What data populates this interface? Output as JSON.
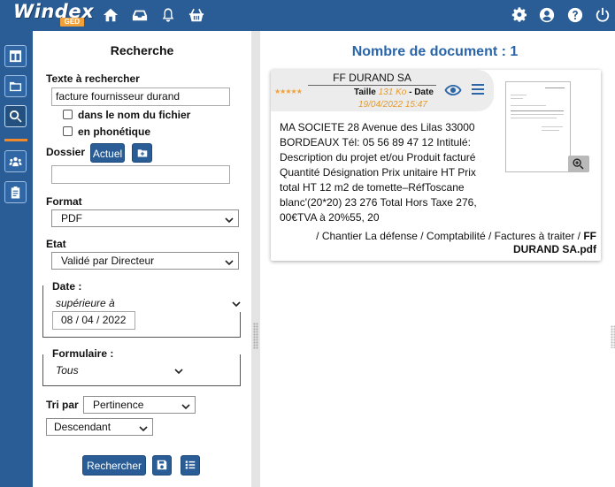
{
  "app": {
    "logo_text": "Windex",
    "logo_sub": "GED",
    "top_icons_left": [
      "home-icon",
      "inbox-icon",
      "bell-icon",
      "basket-icon"
    ],
    "top_icons_right": [
      "gear-icon",
      "user-icon",
      "help-icon",
      "power-icon"
    ],
    "accent": "#2a5d96",
    "highlight": "#f0a13a"
  },
  "rail": {
    "items": [
      "columns-icon",
      "folder-icon",
      "search-icon",
      "users-icon",
      "clipboard-icon"
    ]
  },
  "search": {
    "title": "Recherche",
    "text_label": "Texte à rechercher",
    "text_value": "facture fournisseur durand",
    "opt_filename": "dans le nom du fichier",
    "opt_phonetic": "en phonétique",
    "folder_label": "Dossier",
    "folder_button": "Actuel",
    "folder_value": "",
    "format_label": "Format",
    "format_value": "PDF",
    "state_label": "Etat",
    "state_value": "Validé par Directeur",
    "date_label": "Date :",
    "date_operator": "supérieure à",
    "date_value": "08 / 04 / 2022",
    "form_label": "Formulaire :",
    "form_value": "Tous",
    "sort_label": "Tri par",
    "sort_value": "Pertinence",
    "order_value": "Descendant",
    "search_button": "Rechercher"
  },
  "results": {
    "title": "Nombre de document : 1",
    "card": {
      "name": "FF DURAND SA",
      "stars": "★★★★★",
      "size_label": "Taille",
      "size_value": "131 Ko",
      "date_label": "- Date",
      "date_value": "19/04/2022 15:47",
      "summary": "MA SOCIETE 28 Avenue des Lilas 33000 BORDEAUX Tél: 05 56 89 47 12 Intitulé: Description du projet et/ou Produit facturé Quantité Désignation Prix unitaire HT Prix total HT 12 m2 de tomette–RéfToscane blanc'(20*20) 23 276 Total Hors Taxe 276, 00€TVA à 20%55, 20",
      "path": "/  Chantier La défense / Comptabilité / Factures à traiter /",
      "file": "FF DURAND SA.pdf"
    }
  }
}
